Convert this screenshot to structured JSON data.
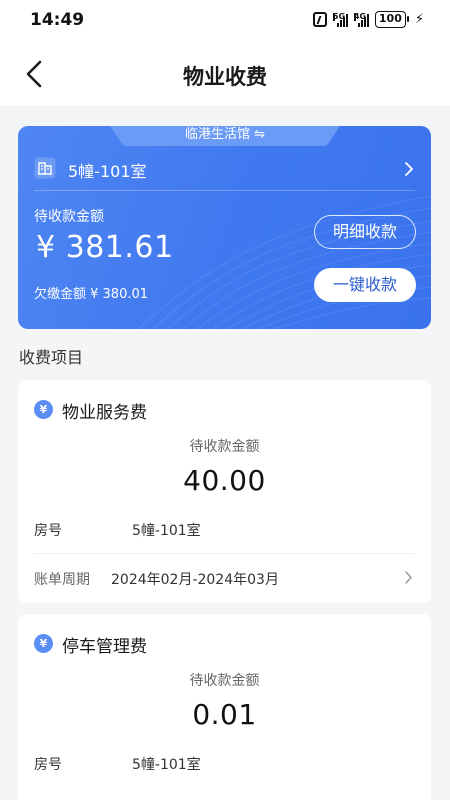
{
  "status_bar": {
    "time": "14:49",
    "network_1": "5G",
    "network_2": "4G",
    "battery": "100",
    "icons": [
      "nfc-icon",
      "signal-5g-icon",
      "signal-4g-icon",
      "battery-icon",
      "charging-icon"
    ]
  },
  "nav": {
    "title": "物业收费",
    "back_icon": "chevron-left-icon"
  },
  "house_card": {
    "community": "临港生活馆 ⇋",
    "house": "5幢-101室",
    "pending_label": "待收款金额",
    "pending_amount": "¥ 381.61",
    "arrears": "欠缴金额 ¥ 380.01",
    "detail_button": "明细收款",
    "pay_all_button": "一键收款",
    "colors": {
      "card_start": "#4f86f3",
      "card_end": "#3a73ec",
      "button_text": "#2d5fd3"
    }
  },
  "section_title": "收费项目",
  "fees": [
    {
      "icon": "¥",
      "name": "物业服务费",
      "amount_label": "待收款金额",
      "amount": "40.00",
      "room_key": "房号",
      "room_value": "5幢-101室",
      "period_key": "账单周期",
      "period_value": "2024年02月-2024年03月"
    },
    {
      "icon": "¥",
      "name": "停车管理费",
      "amount_label": "待收款金额",
      "amount": "0.01",
      "room_key": "房号",
      "room_value": "5幢-101室"
    }
  ]
}
